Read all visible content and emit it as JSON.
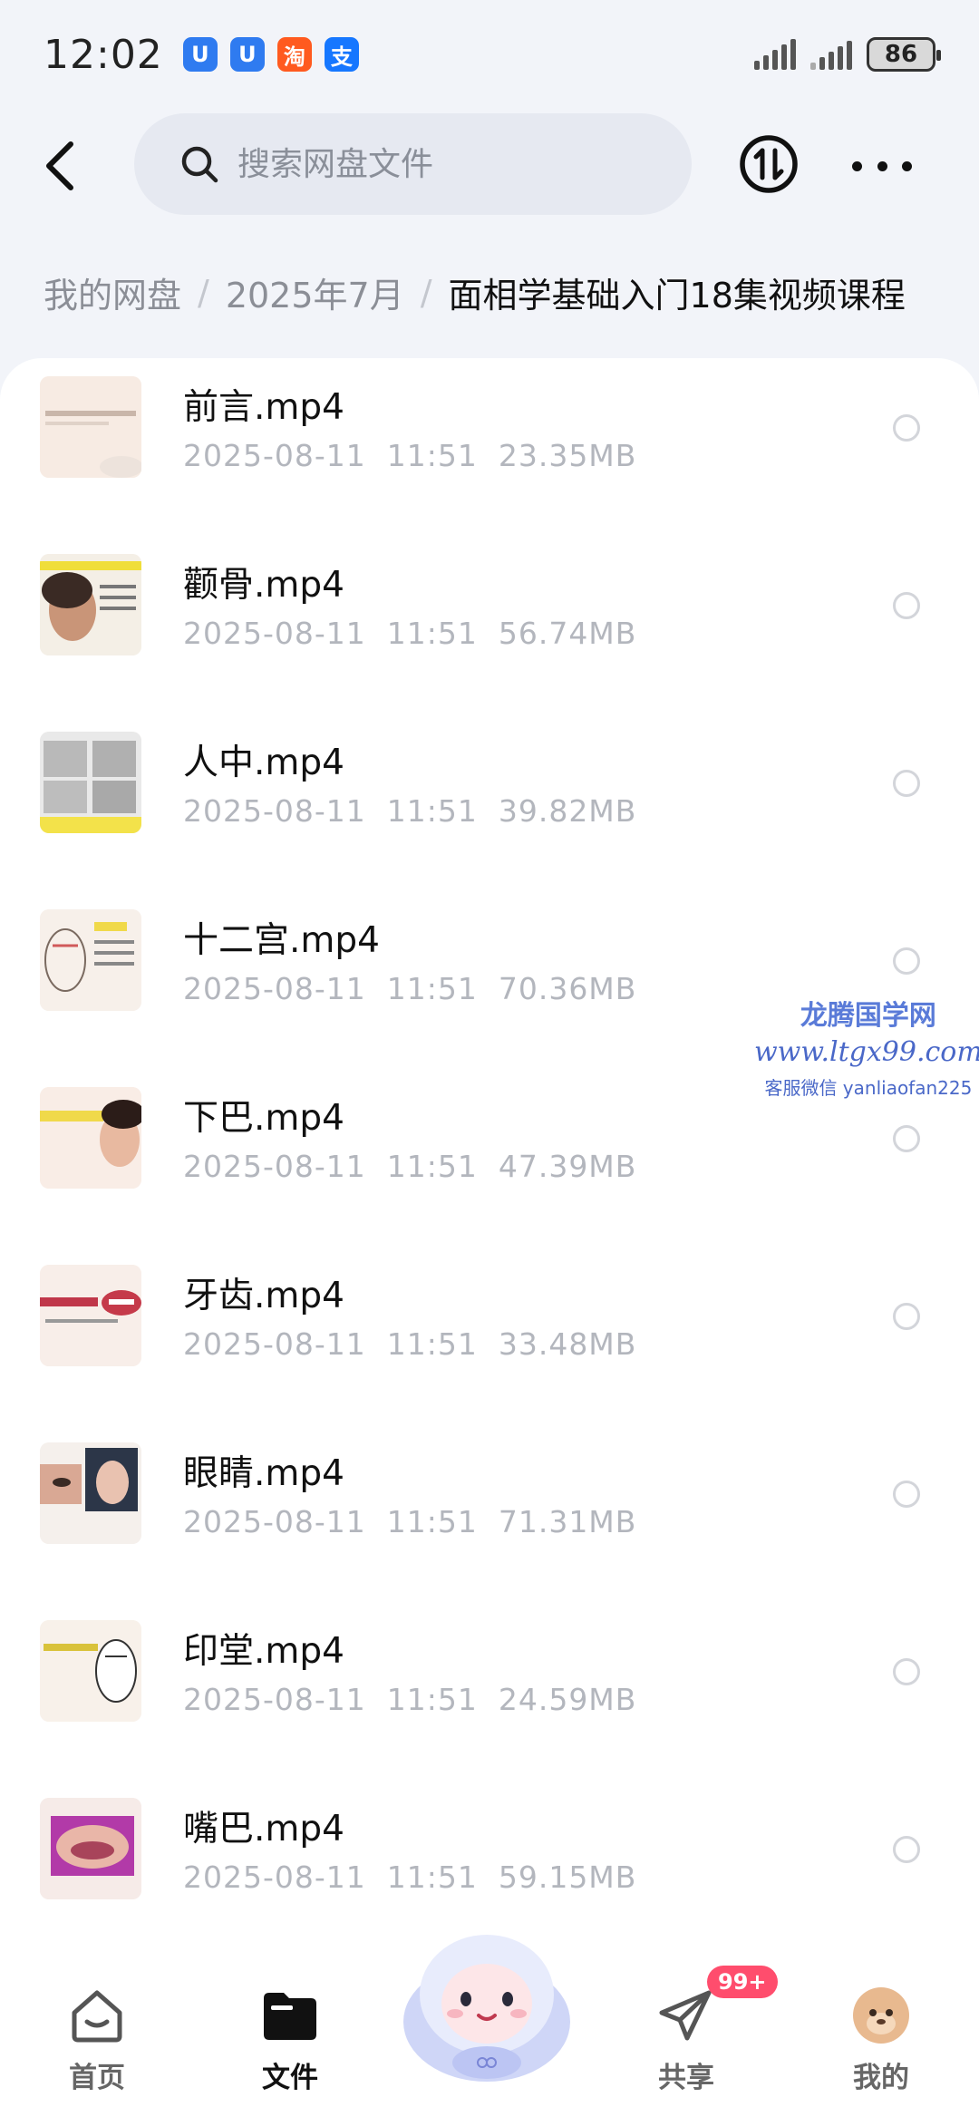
{
  "status_bar": {
    "time": "12:02",
    "app_icons": [
      {
        "name": "uu-app",
        "glyph": "U",
        "color": "#2f7bf0"
      },
      {
        "name": "uu-app-2",
        "glyph": "U",
        "color": "#2f7bf0"
      },
      {
        "name": "taobao-app",
        "glyph": "淘",
        "color": "#ff5a1f"
      },
      {
        "name": "alipay-app",
        "glyph": "支",
        "color": "#1677ff"
      }
    ],
    "battery": "86"
  },
  "header": {
    "search_placeholder": "搜索网盘文件"
  },
  "breadcrumb": {
    "items": [
      "我的网盘",
      "2025年7月"
    ],
    "current": "面相学基础入门18集视频课程",
    "separator": "/"
  },
  "files": [
    {
      "name": "前言.mp4",
      "meta": "2025-08-11  11:51  23.35MB"
    },
    {
      "name": "颧骨.mp4",
      "meta": "2025-08-11  11:51  56.74MB"
    },
    {
      "name": "人中.mp4",
      "meta": "2025-08-11  11:51  39.82MB"
    },
    {
      "name": "十二宫.mp4",
      "meta": "2025-08-11  11:51  70.36MB"
    },
    {
      "name": "下巴.mp4",
      "meta": "2025-08-11  11:51  47.39MB"
    },
    {
      "name": "牙齿.mp4",
      "meta": "2025-08-11  11:51  33.48MB"
    },
    {
      "name": "眼睛.mp4",
      "meta": "2025-08-11  11:51  71.31MB"
    },
    {
      "name": "印堂.mp4",
      "meta": "2025-08-11  11:51  24.59MB"
    },
    {
      "name": "嘴巴.mp4",
      "meta": "2025-08-11  11:51  59.15MB"
    }
  ],
  "watermark": {
    "title": "龙腾国学网",
    "url": "www.ltgx99.com",
    "contact": "客服微信 yanliaofan225"
  },
  "bottom_nav": {
    "home": "首页",
    "files": "文件",
    "share": "共享",
    "mine": "我的",
    "share_badge": "99+"
  },
  "colors": {
    "background": "#f2f4f9",
    "accent_badge": "#ff4d6d",
    "muted_text": "#b3b6bd"
  }
}
